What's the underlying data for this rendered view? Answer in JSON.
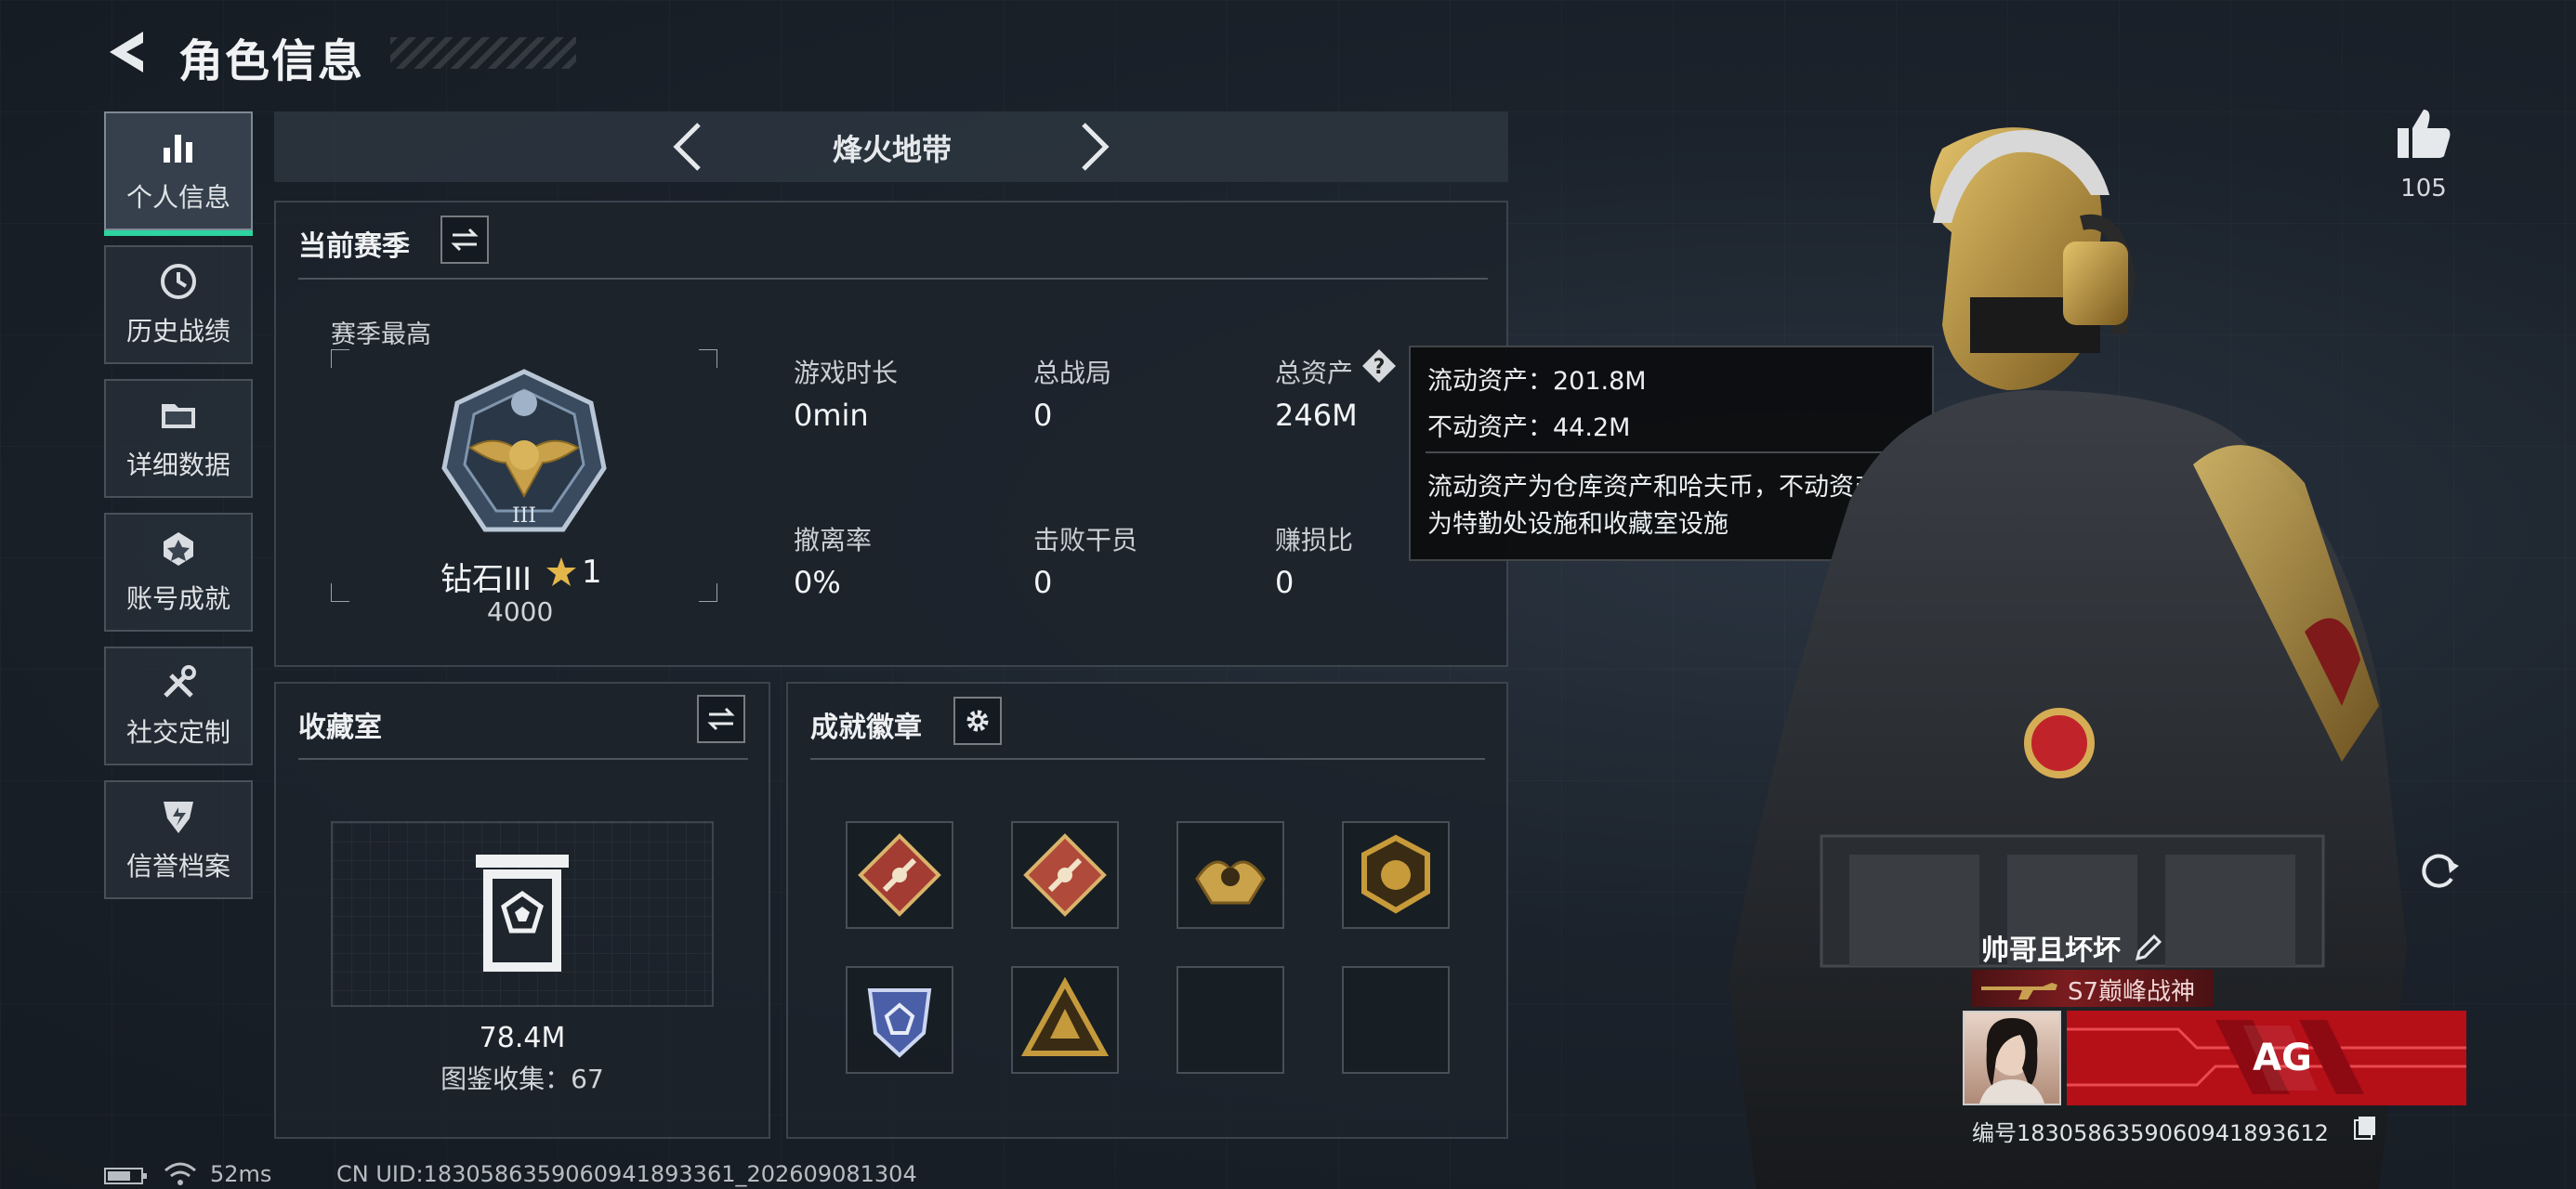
{
  "header": {
    "title": "角色信息"
  },
  "nav": [
    {
      "label": "个人信息",
      "icon": "bar-chart-icon",
      "active": true
    },
    {
      "label": "历史战绩",
      "icon": "clock-icon",
      "active": false
    },
    {
      "label": "详细数据",
      "icon": "folder-icon",
      "active": false
    },
    {
      "label": "账号成就",
      "icon": "medal-icon",
      "active": false
    },
    {
      "label": "社交定制",
      "icon": "tools-icon",
      "active": false
    },
    {
      "label": "信誉档案",
      "icon": "shield-icon",
      "active": false
    }
  ],
  "mode": {
    "label": "烽火地带"
  },
  "season": {
    "title": "当前赛季",
    "best_label": "赛季最高",
    "rank_name": "钻石III",
    "rank_stars": "1",
    "rank_score": "4000",
    "stats": [
      {
        "label": "游戏时长",
        "value": "0min"
      },
      {
        "label": "总战局",
        "value": "0"
      },
      {
        "label": "总资产",
        "value": "246M"
      },
      {
        "label": "撤离率",
        "value": "0%"
      },
      {
        "label": "击败干员",
        "value": "0"
      },
      {
        "label": "赚损比",
        "value": "0"
      }
    ]
  },
  "tooltip": {
    "line1": "流动资产：201.8M",
    "line2": "不动资产：44.2M",
    "line3": "流动资产为仓库资产和哈夫币，不动资产",
    "line4": "为特勤处设施和收藏室设施"
  },
  "collection": {
    "title": "收藏室",
    "value": "78.4M",
    "catalog": "图鉴收集：67"
  },
  "achievements": {
    "title": "成就徽章",
    "badges": [
      {
        "icon": "diamond-sword-badge-icon",
        "color": "#a33d33"
      },
      {
        "icon": "diamond-runner-badge-icon",
        "color": "#b04a3a"
      },
      {
        "icon": "gold-wing-badge-icon",
        "color": "#c9a24a"
      },
      {
        "icon": "gold-emblem-badge-icon",
        "color": "#c79a3a"
      },
      {
        "icon": "blue-shield-badge-icon",
        "color": "#4a5fa8"
      },
      {
        "icon": "gold-triangle-badge-icon",
        "color": "#c59a3c"
      },
      {
        "icon": "empty-slot",
        "color": ""
      },
      {
        "icon": "empty-slot",
        "color": ""
      }
    ]
  },
  "likes": {
    "count": "105"
  },
  "player": {
    "name": "帅哥且坏坏",
    "title": "S7巅峰战神",
    "banner_text": "AG",
    "uid": "编号1830586359060941893612"
  },
  "status": {
    "ping": "52ms",
    "cn_uid": "CN UID:1830586359060941893361_202609081304"
  },
  "colors": {
    "accent": "#2ed3a0",
    "banner": "#b50f18"
  }
}
